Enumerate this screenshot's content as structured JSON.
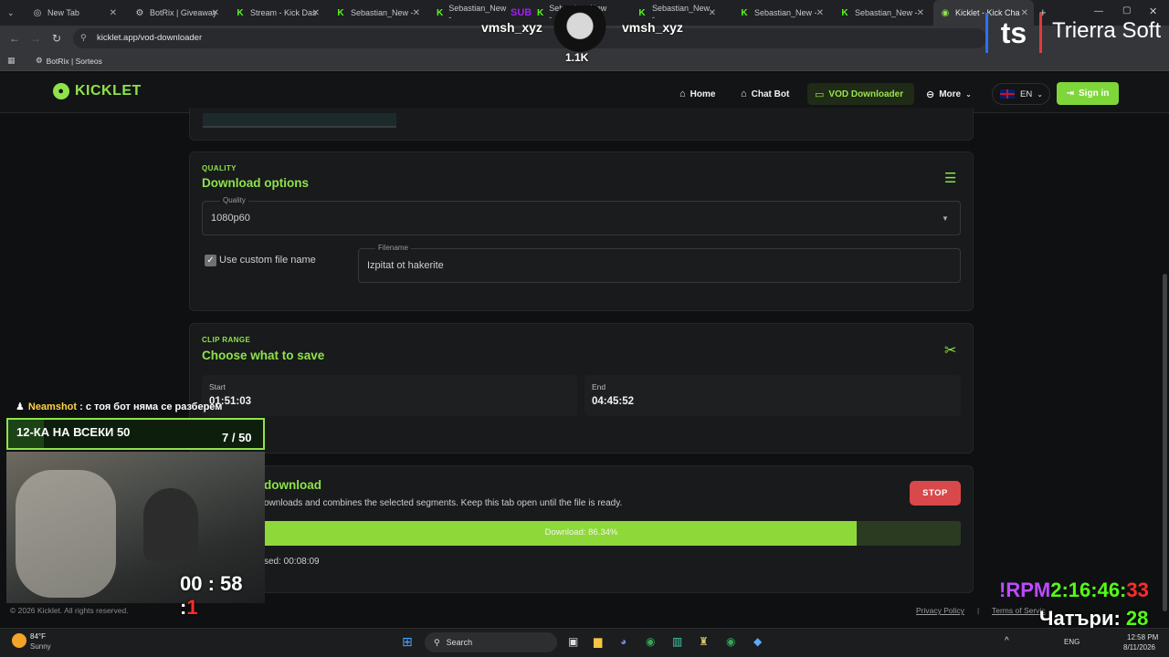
{
  "browser": {
    "tabs": [
      {
        "label": "New Tab",
        "icon": "globe-icon"
      },
      {
        "label": "BotRix | Giveaway",
        "icon": "botrix-icon"
      },
      {
        "label": "Stream - Kick Das",
        "icon": "kick-icon"
      },
      {
        "label": "Sebastian_New -",
        "icon": "kick-icon"
      },
      {
        "label": "Sebastian_New -",
        "icon": "kick-icon"
      },
      {
        "label": "Sebastian_New -",
        "icon": "kick-icon"
      },
      {
        "label": "Sebastian_New -",
        "icon": "kick-icon"
      },
      {
        "label": "Sebastian_New -",
        "icon": "kick-icon"
      },
      {
        "label": "Sebastian_New -",
        "icon": "kick-icon"
      },
      {
        "label": "Kicklet - Kick Cha",
        "icon": "kicklet-icon",
        "active": true
      }
    ],
    "url": "kicklet.app/vod-downloader",
    "bookmark": "BotRix | Sorteos"
  },
  "header": {
    "logo": "KICKLET",
    "nav": {
      "home": "Home",
      "chatbot": "Chat Bot",
      "vod": "VOD Downloader",
      "more": "More"
    },
    "language": "EN",
    "signin": "Sign in"
  },
  "quality": {
    "eyebrow": "QUALITY",
    "title": "Download options",
    "select_label": "Quality",
    "select_value": "1080p60",
    "custom_name_label": "Use custom file name",
    "custom_name_checked": true,
    "filename_label": "Filename",
    "filename_value": "Izpitat ot hakerite"
  },
  "clip": {
    "eyebrow": "CLIP RANGE",
    "title": "Choose what to save",
    "start_label": "Start",
    "start_value": "01:51:03",
    "end_label": "End",
    "end_value": "04:45:52"
  },
  "download": {
    "title": "download",
    "desc": "ownloads and combines the selected segments. Keep this tab open until the file is ready.",
    "stop_label": "STOP",
    "progress_label": "Download: 86.34%",
    "progress": 86.34,
    "elapsed": "sed: 00:08:09"
  },
  "footer": {
    "copyright": "© 2026 Kicklet. All rights reserved.",
    "privacy": "Privacy Policy",
    "terms": "Terms of Servic"
  },
  "overlay": {
    "alert_user": "Neamshot",
    "alert_msg": ": с тоя бот няма се разберем",
    "goal_label": "12-КА НА ВСЕКИ 50",
    "goal_count": "7 / 50",
    "goal_progress": 0.14,
    "timer": "00 : 58 :",
    "timer_red": "1",
    "top_name_left": "vmsh_xyz",
    "top_name_right": "vmsh_xyz",
    "top_badge": "SUB",
    "top_count": "1.1K",
    "brand": "Trierra Soft",
    "brand_mark": "ts",
    "rpm_label": "!RPM",
    "rpm_time": "2:16:46:",
    "rpm_red": "33",
    "bottom_right": "Чатъри:",
    "bottom_right_num": "28"
  },
  "taskbar": {
    "weather_temp": "84°F",
    "weather_desc": "Sunny",
    "search": "Search",
    "lang": "ENG",
    "time": "12:58 PM",
    "date": "8/11/2026"
  },
  "colors": {
    "accent": "#8ee34a",
    "stop": "#d9484a",
    "progress": "#8fd83a"
  }
}
